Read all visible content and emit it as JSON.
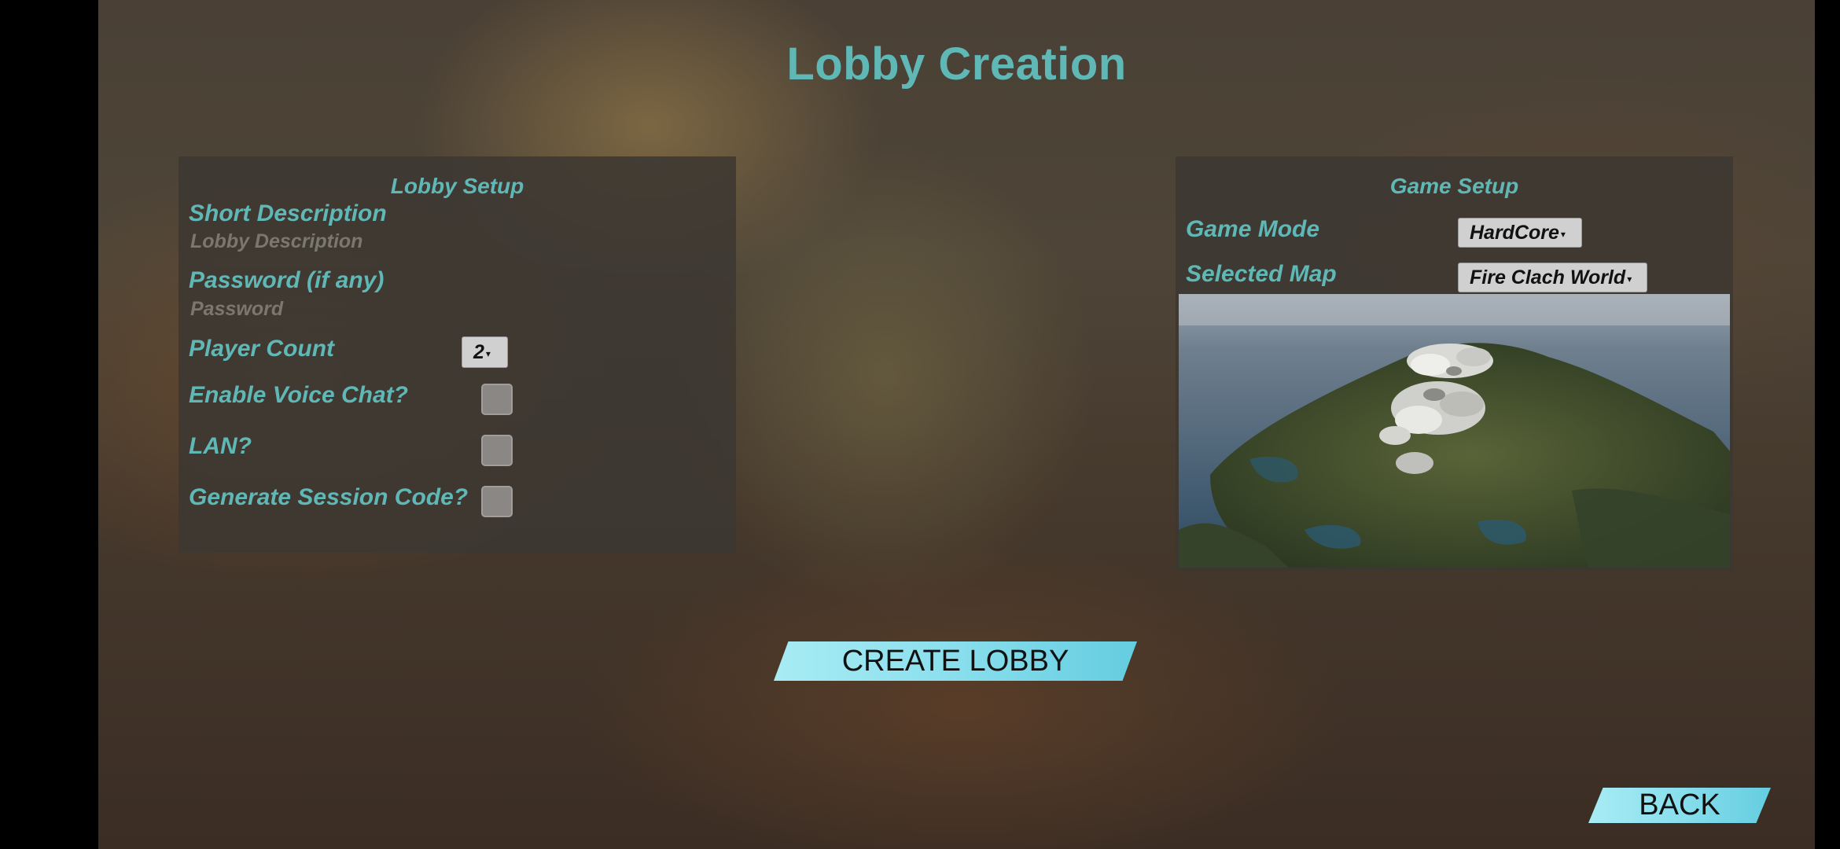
{
  "title": "Lobby Creation",
  "lobby_setup": {
    "heading": "Lobby Setup",
    "short_description_label": "Short Description",
    "short_description_placeholder": "Lobby Description",
    "password_label": "Password (if any)",
    "password_placeholder": "Password",
    "player_count_label": "Player Count",
    "player_count_value": "2",
    "voice_chat_label": "Enable Voice Chat?",
    "voice_chat_checked": false,
    "lan_label": "LAN?",
    "lan_checked": false,
    "session_code_label": "Generate Session Code?",
    "session_code_checked": false
  },
  "game_setup": {
    "heading": "Game Setup",
    "game_mode_label": "Game Mode",
    "game_mode_value": "HardCore",
    "selected_map_label": "Selected Map",
    "selected_map_value": "Fire Clach World"
  },
  "buttons": {
    "create_lobby": "CREATE LOBBY",
    "back": "BACK"
  },
  "colors": {
    "accent_teal": "#5fb8b6",
    "button_cyan": "#8de0ee"
  }
}
